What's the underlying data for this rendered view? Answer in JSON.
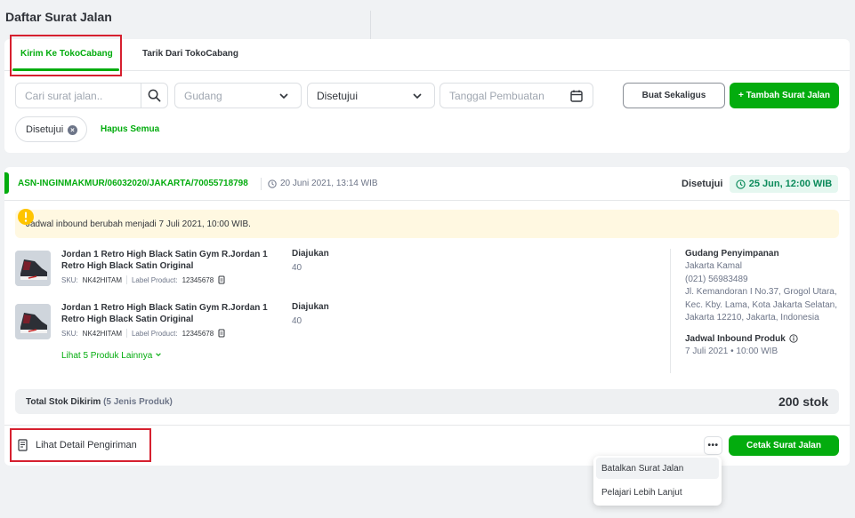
{
  "page": {
    "title": "Daftar Surat Jalan"
  },
  "tabs": [
    {
      "label": "Kirim Ke TokoCabang",
      "active": true
    },
    {
      "label": "Tarik Dari TokoCabang",
      "active": false
    }
  ],
  "filters": {
    "search_placeholder": "Cari surat jalan..",
    "warehouse_placeholder": "Gudang",
    "status_value": "Disetujui",
    "date_placeholder": "Tanggal Pembuatan",
    "bulk_button": "Buat Sekaligus",
    "add_button": "+ Tambah Surat Jalan",
    "active_chip": "Disetujui",
    "clear_all": "Hapus Semua"
  },
  "order": {
    "id": "ASN-INGINMAKMUR/06032020/JAKARTA/70055718798",
    "created_at": "20 Juni 2021, 13:14 WIB",
    "status": "Disetujui",
    "schedule_badge": "25 Jun, 12:00 WIB",
    "notice": "Jadwal inbound berubah menjadi 7 Juli 2021, 10:00 WIB.",
    "products": [
      {
        "name": "Jordan 1 Retro High Black Satin Gym R.Jordan 1 Retro High Black Satin Original",
        "sku_label": "SKU:",
        "sku": "NK42HITAM",
        "product_label_label": "Label Product:",
        "product_label": "12345678",
        "status": "Diajukan",
        "qty": "40"
      },
      {
        "name": "Jordan 1 Retro High Black Satin Gym R.Jordan 1 Retro High Black Satin Original",
        "sku_label": "SKU:",
        "sku": "NK42HITAM",
        "product_label_label": "Label Product:",
        "product_label": "12345678",
        "status": "Diajukan",
        "qty": "40"
      }
    ],
    "more_products": "Lihat 5 Produk Lainnya",
    "warehouse": {
      "title": "Gudang Penyimpanan",
      "name": "Jakarta Kamal",
      "phone": "(021) 56983489",
      "address": "Jl. Kemandoran I No.37, Grogol Utara, Kec. Kby. Lama, Kota Jakarta Selatan, Jakarta 12210, Jakarta, Indonesia",
      "schedule_title": "Jadwal Inbound Produk",
      "schedule_value": "7 Juli 2021 • 10:00 WIB"
    },
    "total": {
      "label": "Total Stok Dikirim",
      "sub": "(5 Jenis Produk)",
      "value": "200 stok"
    },
    "detail_link": "Lihat Detail Pengiriman",
    "more_button": "•••",
    "print_button": "Cetak Surat Jalan"
  },
  "menu": {
    "items": [
      "Batalkan Surat Jalan",
      "Pelajari Lebih Lanjut"
    ]
  },
  "colors": {
    "accent": "#03ac0e",
    "highlight": "#d6202f",
    "notice_bg": "#fff8e1",
    "badge_bg": "#e5f7f0"
  }
}
